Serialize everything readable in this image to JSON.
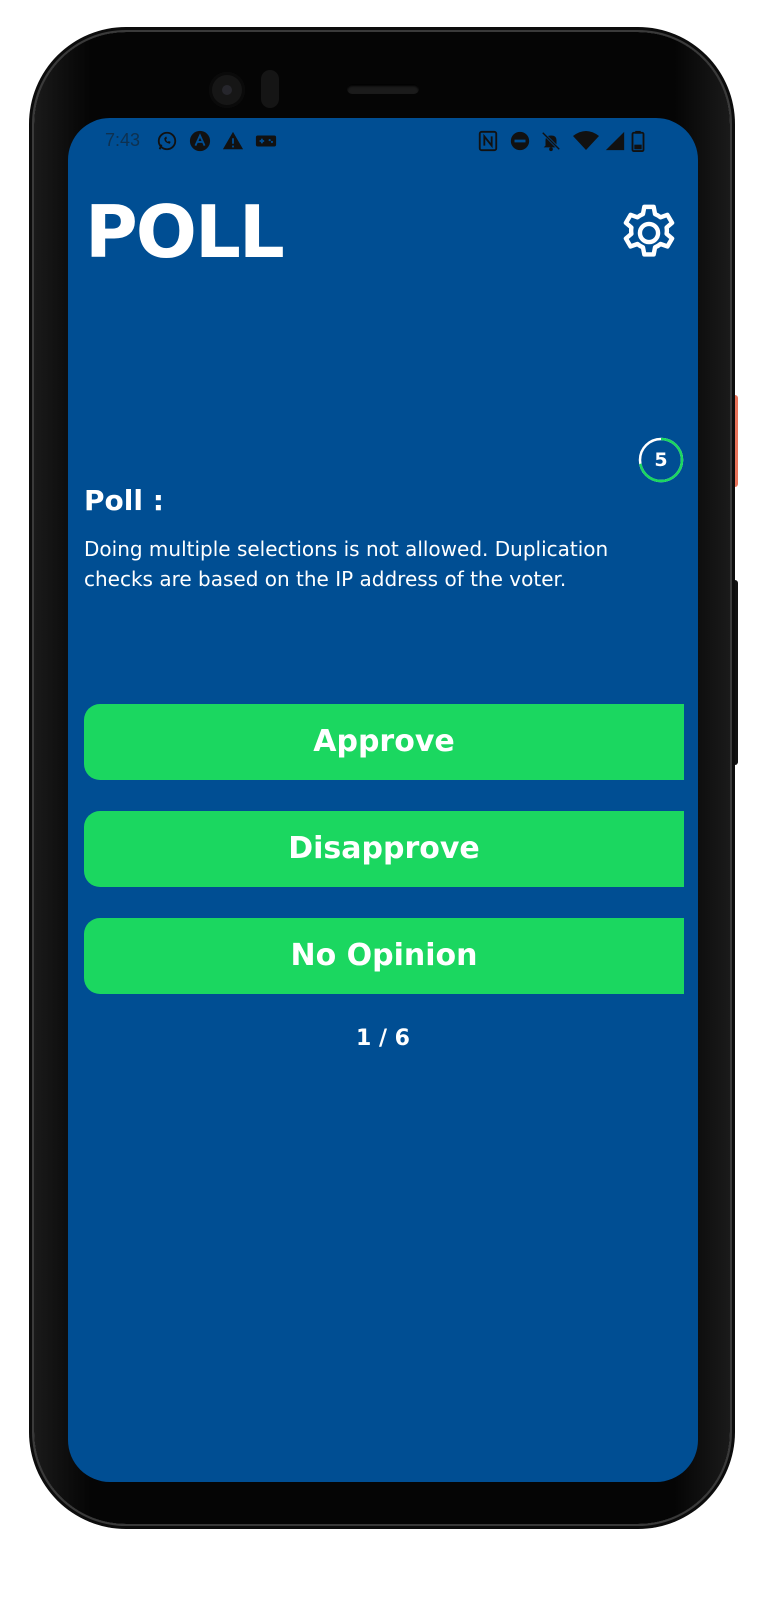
{
  "status_bar": {
    "time": "7:43",
    "left_icons": [
      "whatsapp-icon",
      "app-a-icon",
      "warning-icon",
      "game-icon"
    ],
    "right_icons": [
      "nfc-icon",
      "dnd-icon",
      "mute-icon",
      "wifi-icon",
      "signal-icon",
      "battery-icon"
    ]
  },
  "header": {
    "title": "POLL",
    "settings_icon": "gear-icon"
  },
  "timer": {
    "value": "5",
    "color": "#1bd760"
  },
  "poll": {
    "heading": "Poll :",
    "description": "Doing multiple selections is not allowed. Duplication checks are based on the IP address of the voter.",
    "options": [
      "Approve",
      "Disapprove",
      "No Opinion"
    ],
    "option_color": "#1bd760"
  },
  "pager": {
    "text": "1 / 6"
  },
  "colors": {
    "background": "#004e93",
    "accent": "#1bd760",
    "text": "#ffffff"
  }
}
